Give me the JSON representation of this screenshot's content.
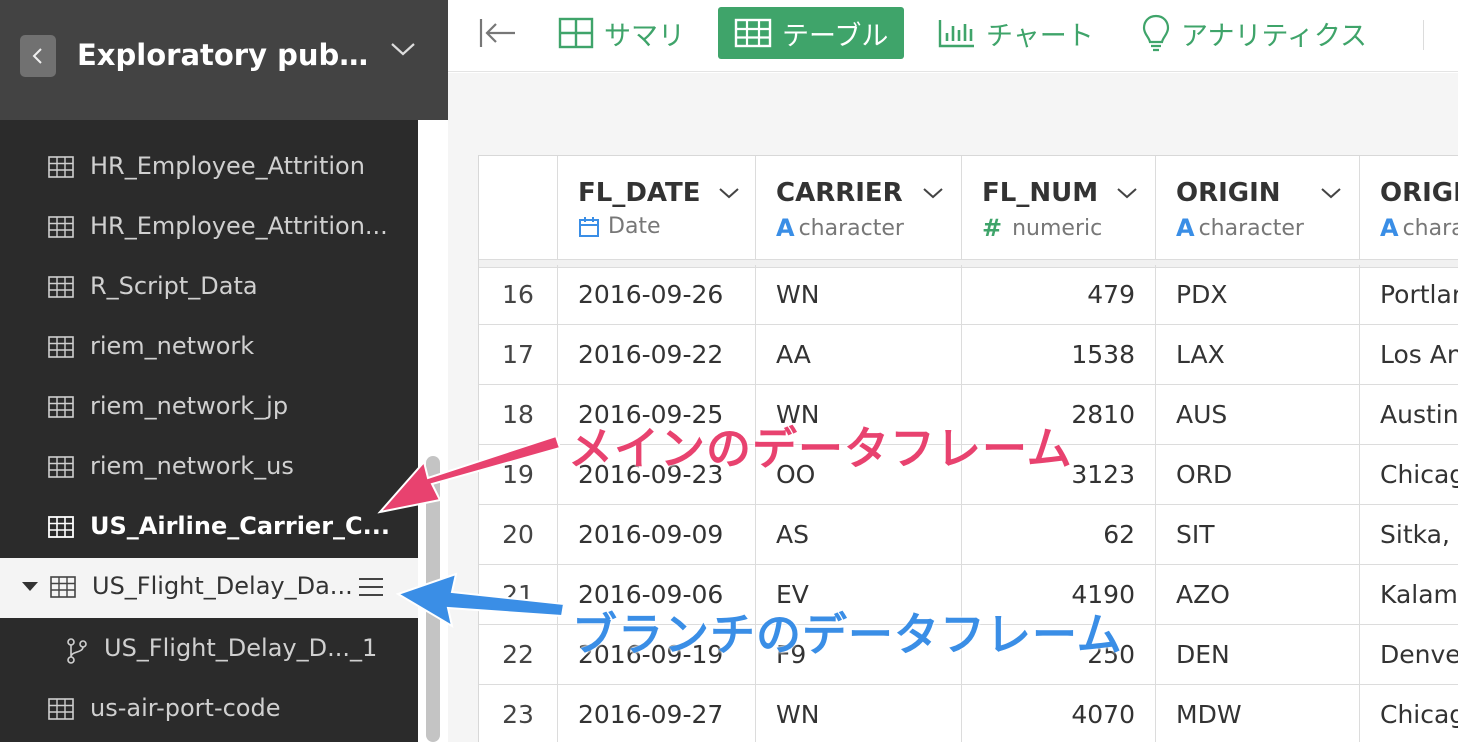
{
  "sidebar": {
    "back_icon": "chevron-left-icon",
    "project_title": "Exploratory publi...",
    "items": [
      {
        "label": "HR_Employee_Attrition",
        "icon": "table-icon"
      },
      {
        "label": "HR_Employee_Attrition...",
        "icon": "table-icon"
      },
      {
        "label": "R_Script_Data",
        "icon": "table-icon"
      },
      {
        "label": "riem_network",
        "icon": "table-icon"
      },
      {
        "label": "riem_network_jp",
        "icon": "table-icon"
      },
      {
        "label": "riem_network_us",
        "icon": "table-icon"
      },
      {
        "label": "US_Airline_Carrier_C...",
        "icon": "table-icon",
        "state": "active"
      },
      {
        "label": "US_Flight_Delay_Da...",
        "icon": "table-icon",
        "state": "selected-expanded"
      },
      {
        "label": "US_Flight_Delay_D..._1",
        "icon": "branch-icon",
        "state": "branch"
      },
      {
        "label": "us-air-port-code",
        "icon": "table-icon"
      }
    ]
  },
  "toolbar": {
    "tabs": [
      {
        "label": "サマリ",
        "icon": "summary-grid-icon"
      },
      {
        "label": "テーブル",
        "icon": "table-icon",
        "active": true
      },
      {
        "label": "チャート",
        "icon": "bar-chart-icon"
      },
      {
        "label": "アナリティクス",
        "icon": "lightbulb-icon"
      }
    ]
  },
  "table": {
    "columns": [
      {
        "name": "FL_DATE",
        "type": "Date",
        "type_icon": "calendar-icon"
      },
      {
        "name": "CARRIER",
        "type": "character",
        "type_icon": "A"
      },
      {
        "name": "FL_NUM",
        "type": "numeric",
        "type_icon": "#"
      },
      {
        "name": "ORIGIN",
        "type": "character",
        "type_icon": "A"
      },
      {
        "name": "ORIGI",
        "type": "chara",
        "type_icon": "A"
      }
    ],
    "rows": [
      {
        "n": "16",
        "date": "2016-09-26",
        "carrier": "WN",
        "num": "479",
        "origin": "PDX",
        "city": "Portlan"
      },
      {
        "n": "17",
        "date": "2016-09-22",
        "carrier": "AA",
        "num": "1538",
        "origin": "LAX",
        "city": "Los An"
      },
      {
        "n": "18",
        "date": "2016-09-25",
        "carrier": "WN",
        "num": "2810",
        "origin": "AUS",
        "city": "Austin"
      },
      {
        "n": "19",
        "date": "2016-09-23",
        "carrier": "OO",
        "num": "3123",
        "origin": "ORD",
        "city": "Chicag"
      },
      {
        "n": "20",
        "date": "2016-09-09",
        "carrier": "AS",
        "num": "62",
        "origin": "SIT",
        "city": "Sitka,"
      },
      {
        "n": "21",
        "date": "2016-09-06",
        "carrier": "EV",
        "num": "4190",
        "origin": "AZO",
        "city": "Kalam"
      },
      {
        "n": "22",
        "date": "2016-09-19",
        "carrier": "F9",
        "num": "250",
        "origin": "DEN",
        "city": "Denve"
      },
      {
        "n": "23",
        "date": "2016-09-27",
        "carrier": "WN",
        "num": "4070",
        "origin": "MDW",
        "city": "Chicag"
      }
    ]
  },
  "annotations": {
    "main_label": "メインのデータフレーム",
    "branch_label": "ブランチのデータフレーム",
    "main_color": "#e8426f",
    "branch_color": "#3a8ee6"
  },
  "colors": {
    "accent_green": "#3fa46a",
    "sidebar_bg": "#2b2b2b",
    "sidebar_header_bg": "#434343"
  }
}
